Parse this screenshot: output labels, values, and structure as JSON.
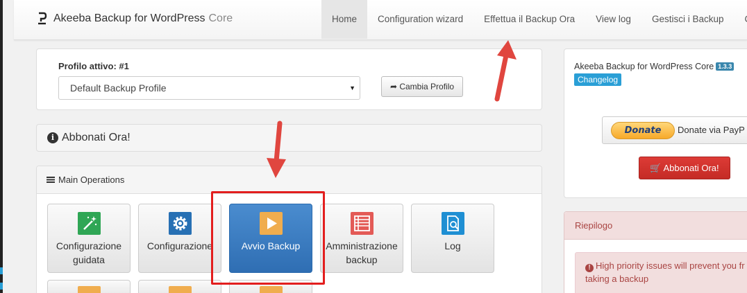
{
  "navbar": {
    "brand_title": "Akeeba Backup for WordPress",
    "brand_edition": "Core",
    "items": [
      {
        "label": "Home",
        "active": true
      },
      {
        "label": "Configuration wizard"
      },
      {
        "label": "Effettua il Backup Ora"
      },
      {
        "label": "View log"
      },
      {
        "label": "Gestisci i Backup"
      },
      {
        "label": "Co"
      }
    ]
  },
  "profile": {
    "label": "Profilo attivo: #1",
    "selected": "Default Backup Profile",
    "switch_label": "Cambia Profilo"
  },
  "subscribe_bar": {
    "title": "Abbonati Ora!"
  },
  "main_operations": {
    "heading": "Main Operations",
    "buttons": [
      {
        "label": "Configurazione guidata",
        "icon": "magic-wand-icon"
      },
      {
        "label": "Configurazione",
        "icon": "gear-icon"
      },
      {
        "label": "Avvio Backup",
        "icon": "play-icon"
      },
      {
        "label": "Amministrazione backup",
        "icon": "list-icon"
      },
      {
        "label": "Log",
        "icon": "log-search-icon"
      }
    ]
  },
  "about": {
    "title": "Akeeba Backup for WordPress Core",
    "version": "1.3.3",
    "changelog": "Changelog",
    "donate_button": "Donate",
    "donate_text": "Donate via PayP",
    "subscribe_button": "Abbonati Ora!"
  },
  "summary": {
    "heading": "Riepilogo",
    "alert": "High priority issues will prevent you fr taking a backup"
  },
  "colors": {
    "primary": "#337ab7",
    "danger": "#d9534f",
    "annotation": "#e31e1e"
  }
}
